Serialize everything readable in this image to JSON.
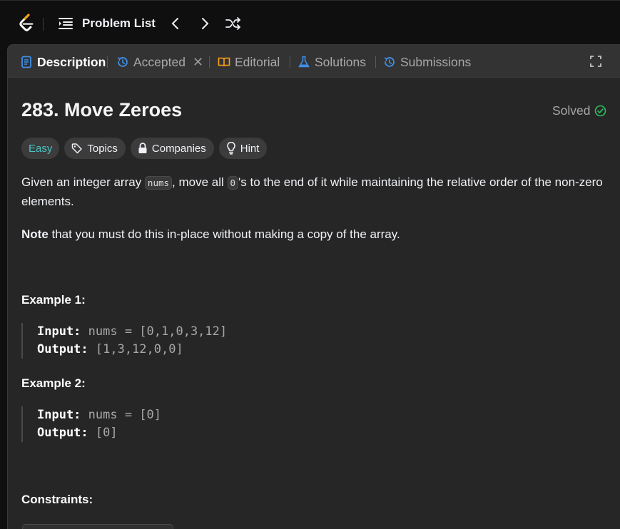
{
  "topbar": {
    "problem_list_label": "Problem List"
  },
  "tabs": [
    {
      "label": "Description"
    },
    {
      "label": "Accepted"
    },
    {
      "label": "Editorial"
    },
    {
      "label": "Solutions"
    },
    {
      "label": "Submissions"
    }
  ],
  "problem": {
    "title": "283. Move Zeroes",
    "status": "Solved",
    "difficulty": "Easy",
    "chips": [
      "Topics",
      "Companies",
      "Hint"
    ],
    "desc_part1": "Given an integer array ",
    "desc_code1": "nums",
    "desc_part2": ", move all ",
    "desc_code2": "0",
    "desc_part3": "'s to the end of it while maintaining the relative order of the non-zero elements.",
    "note_bold": "Note",
    "note_rest": " that you must do this in-place without making a copy of the array.",
    "examples": [
      {
        "heading": "Example 1:",
        "input_label": "Input:",
        "input_value": " nums = [0,1,0,3,12]",
        "output_label": "Output:",
        "output_value": " [1,3,12,0,0]"
      },
      {
        "heading": "Example 2:",
        "input_label": "Input:",
        "input_value": " nums = [0]",
        "output_label": "Output:",
        "output_value": " [0]"
      }
    ],
    "constraints_heading": "Constraints:"
  },
  "colors": {
    "easy": "#46c6c2",
    "solved_check": "#2cbb5d",
    "description_icon": "#3f8fe6",
    "editorial_icon": "#ffa116",
    "solutions_icon": "#3f8fe6",
    "logo_orange": "#ffa116"
  },
  "icons": [
    "leetcode-logo",
    "list-icon",
    "chevron-left-icon",
    "chevron-right-icon",
    "shuffle-icon",
    "expand-icon",
    "tag-icon",
    "lock-icon",
    "bulb-icon",
    "check-circle-icon"
  ]
}
